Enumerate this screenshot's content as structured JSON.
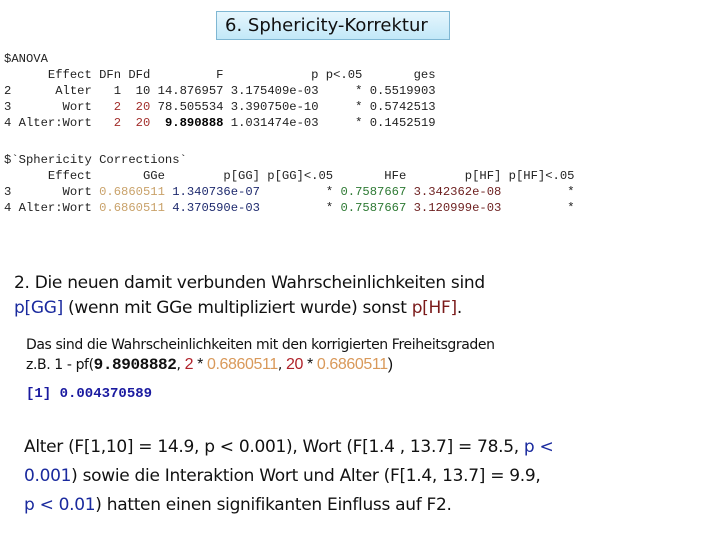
{
  "title": "6. Sphericity-Korrektur",
  "anova": {
    "header_label": "$ANOVA",
    "columns": [
      "Effect",
      "DFn",
      "DFd",
      "F",
      "p",
      "p<.05",
      "ges"
    ],
    "rows": [
      {
        "idx": "2",
        "effect": "Alter",
        "dfn": "1",
        "dfd": "10",
        "f": "14.876957",
        "p": "3.175409e-03",
        "sig": "*",
        "ges": "0.5519903"
      },
      {
        "idx": "3",
        "effect": "Wort",
        "dfn": "2",
        "dfd": "20",
        "f": "78.505534",
        "p": "3.390750e-10",
        "sig": "*",
        "ges": "0.5742513"
      },
      {
        "idx": "4",
        "effect": "Alter:Wort",
        "dfn": "2",
        "dfd": "20",
        "f": "9.890888",
        "p": "1.031474e-03",
        "sig": "*",
        "ges": "0.1452519"
      }
    ]
  },
  "sphericity": {
    "header_label": "$`Sphericity Corrections`",
    "columns": [
      "Effect",
      "GGe",
      "p[GG]",
      "p[GG]<.05",
      "HFe",
      "p[HF]",
      "p[HF]<.05"
    ],
    "rows": [
      {
        "idx": "3",
        "effect": "Wort",
        "gge": "0.6860511",
        "pgg": "1.340736e-07",
        "sig_gg": "*",
        "hfe": "0.7587667",
        "phf": "3.342362e-08",
        "sig_hf": "*"
      },
      {
        "idx": "4",
        "effect": "Alter:Wort",
        "gge": "0.6860511",
        "pgg": "4.370590e-03",
        "sig_gg": "*",
        "hfe": "0.7587667",
        "phf": "3.120999e-03",
        "sig_hf": "*"
      }
    ]
  },
  "para1": {
    "line1": "2. Die neuen damit verbunden Wahrscheinlichkeiten sind",
    "pgg": "p[GG]",
    "middle": " (wenn mit GGe multipliziert wurde) sonst ",
    "phf": "p[HF]",
    "end": "."
  },
  "para2": {
    "line1": "Das sind die Wahrscheinlichkeiten mit den korrigierten Freiheitsgraden",
    "prefix": "z.B. 1 - pf(",
    "fval": "9.8908882",
    "sep1": ", ",
    "n1": "2",
    "mult1": " * ",
    "gge1": "0.6860511",
    "sep2": ", ",
    "n2": "20",
    "mult2": " * ",
    "gge2": "0.6860511",
    "close": ")"
  },
  "result": "[1] 0.004370589",
  "para3": {
    "l1a": "Alter (F[1,10] = 14.9, p < 0.001), Wort (F[1.4 , 13.7] = 78.5, ",
    "l1b": "p <",
    "l2a": "0.001",
    "l2b": ") sowie die Interaktion Wort  und Alter (F[1.4, 13.7] = 9.9,",
    "l3a": "p < 0.01",
    "l3b": ") hatten einen signifikanten Einfluss auf F2."
  }
}
